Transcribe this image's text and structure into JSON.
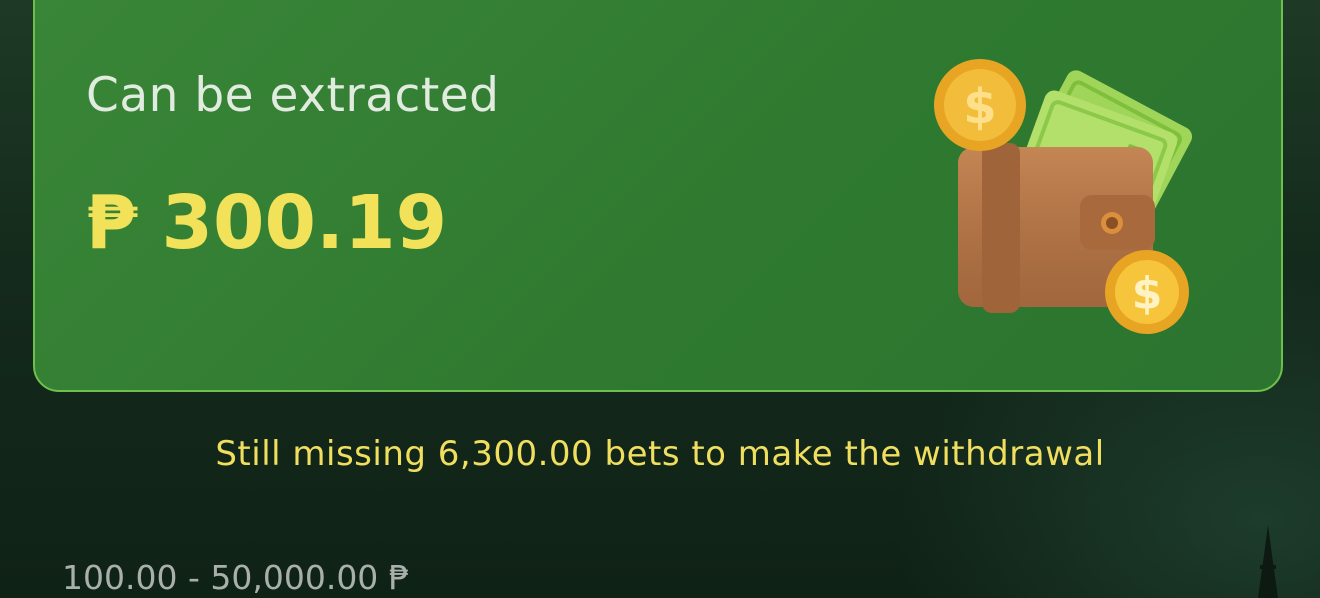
{
  "withdraw_card": {
    "title": "Can be extracted",
    "currency_symbol": "₱",
    "amount": "300.19",
    "illustration_icon": "wallet-with-coins-icon"
  },
  "notice": {
    "prefix": "Still missing ",
    "amount": "6,300.00",
    "suffix": " bets to make the withdrawal"
  },
  "limits": {
    "range": "100.00 - 50,000.00 ₱"
  },
  "colors": {
    "card_bg": "#2f7a30",
    "card_border": "#6fbf4c",
    "amount": "#f2e25a",
    "notice_text": "#f0de5e",
    "page_bg": "#142a1c"
  }
}
